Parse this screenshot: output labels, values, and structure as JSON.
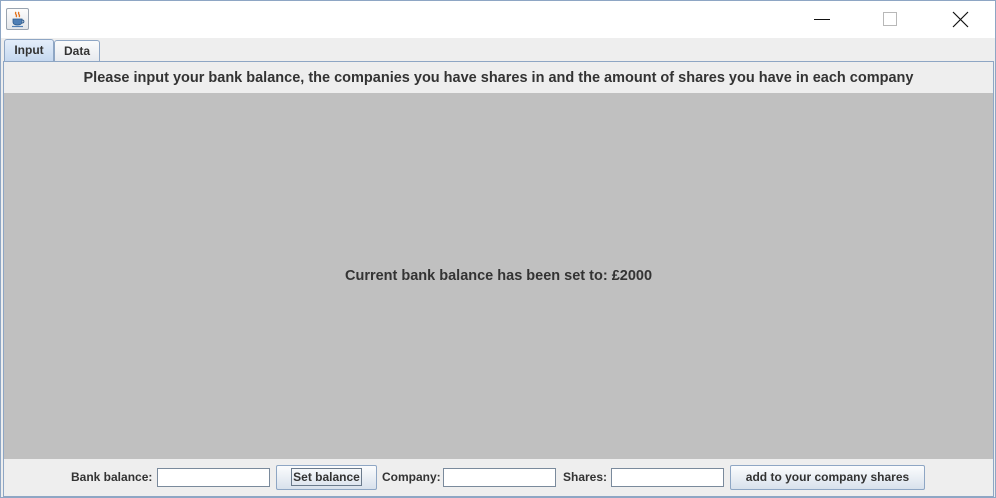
{
  "window": {
    "app_icon": "java-coffee-cup-icon",
    "controls": [
      "minimize-icon",
      "maximize-icon",
      "close-icon"
    ]
  },
  "tabs": [
    {
      "label": "Input",
      "selected": true
    },
    {
      "label": "Data",
      "selected": false
    }
  ],
  "input_panel": {
    "header": "Please input your bank balance, the companies you have shares in and the amount of shares you have in each company",
    "status_message": "Current bank balance has been set to: £2000",
    "center_color": "#c0c0c0"
  },
  "form": {
    "bank_balance_label": "Bank balance:",
    "bank_balance_value": "",
    "set_balance_button": "Set balance",
    "company_label": "Company:",
    "company_value": "",
    "shares_label": "Shares:",
    "shares_value": "",
    "add_button": "add to your company shares"
  }
}
